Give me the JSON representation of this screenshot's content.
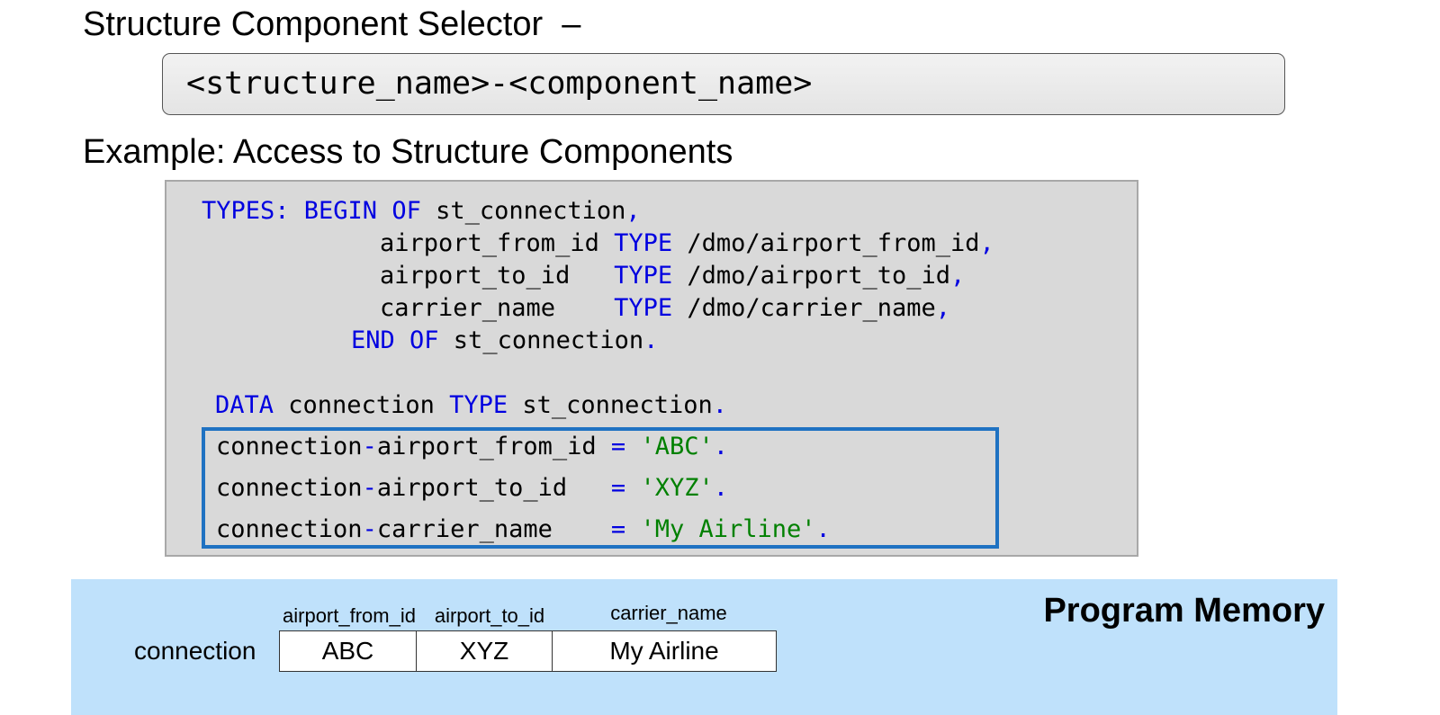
{
  "headings": {
    "selector_title": "Structure Component Selector  –",
    "example_title": "Example: Access to Structure Components"
  },
  "syntax": "<structure_name>-<component_name>",
  "code_lines": [
    [
      {
        "t": "TYPES: BEGIN OF",
        "c": "kw"
      },
      {
        "t": " st_connection",
        "c": ""
      },
      {
        "t": ",",
        "c": "op"
      }
    ],
    [
      {
        "t": "airport_from_id ",
        "c": ""
      },
      {
        "t": "TYPE",
        "c": "kw"
      },
      {
        "t": " /dmo/airport_from_id",
        "c": ""
      },
      {
        "t": ",",
        "c": "op"
      }
    ],
    [
      {
        "t": "airport_to_id   ",
        "c": ""
      },
      {
        "t": "TYPE",
        "c": "kw"
      },
      {
        "t": " /dmo/airport_to_id",
        "c": ""
      },
      {
        "t": ",",
        "c": "op"
      }
    ],
    [
      {
        "t": "carrier_name    ",
        "c": ""
      },
      {
        "t": "TYPE",
        "c": "kw"
      },
      {
        "t": " /dmo/carrier_name",
        "c": ""
      },
      {
        "t": ",",
        "c": "op"
      }
    ],
    [
      {
        "t": "END OF",
        "c": "kw"
      },
      {
        "t": " st_connection",
        "c": ""
      },
      {
        "t": ".",
        "c": "op"
      }
    ],
    [
      {
        "t": "DATA",
        "c": "kw"
      },
      {
        "t": " connection ",
        "c": ""
      },
      {
        "t": "TYPE",
        "c": "kw"
      },
      {
        "t": " st_connection",
        "c": ""
      },
      {
        "t": ".",
        "c": "op"
      }
    ],
    [
      {
        "t": "connection",
        "c": ""
      },
      {
        "t": "-",
        "c": "op"
      },
      {
        "t": "airport_from_id ",
        "c": ""
      },
      {
        "t": "=",
        "c": "op"
      },
      {
        "t": " 'ABC'",
        "c": "str"
      },
      {
        "t": ".",
        "c": "op"
      }
    ],
    [
      {
        "t": "connection",
        "c": ""
      },
      {
        "t": "-",
        "c": "op"
      },
      {
        "t": "airport_to_id   ",
        "c": ""
      },
      {
        "t": "=",
        "c": "op"
      },
      {
        "t": " 'XYZ'",
        "c": "str"
      },
      {
        "t": ".",
        "c": "op"
      }
    ],
    [
      {
        "t": "connection",
        "c": ""
      },
      {
        "t": "-",
        "c": "op"
      },
      {
        "t": "carrier_name    ",
        "c": ""
      },
      {
        "t": "=",
        "c": "op"
      },
      {
        "t": " 'My Airline'",
        "c": "str"
      },
      {
        "t": ".",
        "c": "op"
      }
    ]
  ],
  "memory": {
    "title": "Program Memory",
    "label": "connection",
    "columns": [
      {
        "header": "airport_from_id",
        "value": "ABC"
      },
      {
        "header": "airport_to_id",
        "value": "XYZ"
      },
      {
        "header": "carrier_name",
        "value": "My Airline"
      }
    ]
  },
  "colors": {
    "keyword": "#0000e0",
    "string": "#008000",
    "highlight_border": "#1f72c2",
    "memory_panel": "#bfe1fb",
    "code_background": "#d9d9d9"
  }
}
